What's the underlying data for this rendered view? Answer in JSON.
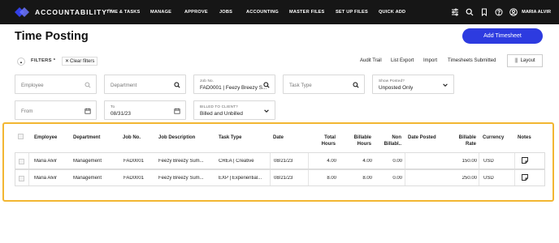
{
  "nav": {
    "brand": "ACCOUNTABILITY",
    "brand_mark": "TM",
    "items": [
      "TIME & TASKS",
      "MANAGE",
      "APPROVE",
      "JOBS",
      "ACCOUNTING",
      "MASTER FILES",
      "SET UP FILES",
      "QUICK ADD"
    ],
    "icons": [
      "sliders-icon",
      "search-icon",
      "bookmark-icon",
      "help-icon",
      "user-avatar-icon"
    ],
    "user_name": "MARIA ALVIR"
  },
  "header": {
    "title": "Time Posting",
    "add_button": "Add Timesheet"
  },
  "filter_bar": {
    "collapse_glyph": "▲",
    "filters_label": "FILTERS",
    "filters_marker": "*",
    "clear_glyph": "✕",
    "clear_label": "Clear filters",
    "links": [
      "Audit Trail",
      "List Export",
      "Import",
      "Timesheets Submitted"
    ],
    "layout_glyph": "|||",
    "layout_label": "Layout"
  },
  "filters": {
    "employee": {
      "placeholder": "Employee"
    },
    "department": {
      "placeholder": "Department"
    },
    "job_no": {
      "label": "Job No.",
      "value": "FAD0001 | Feezy Breezy S..."
    },
    "task_type": {
      "placeholder": "Task Type"
    },
    "show_posted": {
      "label": "Show Posted?",
      "value": "Unposted Only"
    },
    "from": {
      "placeholder": "From"
    },
    "to": {
      "label": "To",
      "value": "08/31/23"
    },
    "billed_to_client": {
      "label": "BILLED TO CLIENT?",
      "value": "Billed and Unbilled"
    }
  },
  "table": {
    "columns": {
      "employee": "Employee",
      "department": "Department",
      "job_no": "Job No.",
      "job_description": "Job Description",
      "task_type": "Task Type",
      "date": "Date",
      "total_hours_1": "Total",
      "total_hours_2": "Hours",
      "billable_hours_1": "Billable",
      "billable_hours_2": "Hours",
      "non_billable_1": "Non",
      "non_billable_2": "Billabl..",
      "date_posted": "Date Posted",
      "billable_rate_1": "Billable",
      "billable_rate_2": "Rate",
      "currency": "Currency",
      "notes": "Notes"
    },
    "rows": [
      {
        "employee": "Maria Alvir",
        "department": "Management",
        "job_no": "FAD0001",
        "job_description": "Feezy Breezy Sum...",
        "task_type": "CREA | Creative",
        "date": "08/21/23",
        "total_hours": "4.00",
        "billable_hours": "4.00",
        "non_billable": "0.00",
        "date_posted": "",
        "billable_rate": "150.00",
        "currency": "USD"
      },
      {
        "employee": "Maria Alvir",
        "department": "Management",
        "job_no": "FAD0001",
        "job_description": "Feezy Breezy Sum...",
        "task_type": "EXP | Experiential...",
        "date": "08/21/23",
        "total_hours": "8.00",
        "billable_hours": "8.00",
        "non_billable": "0.00",
        "date_posted": "",
        "billable_rate": "250.00",
        "currency": "USD"
      }
    ]
  },
  "colors": {
    "nav_bg": "#161616",
    "accent": "#2d3be0",
    "highlight": "#f2b632"
  }
}
